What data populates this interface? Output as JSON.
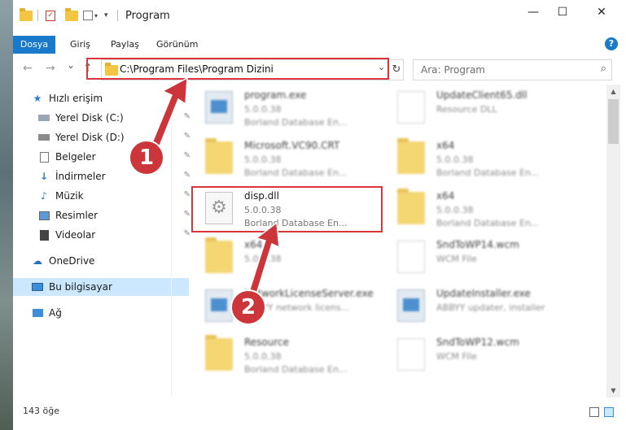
{
  "window": {
    "title": "Program",
    "controls": {
      "minimize": "—",
      "maximize": "☐",
      "close": "✕"
    }
  },
  "ribbon": {
    "tabs": [
      "Dosya",
      "Giriş",
      "Paylaş",
      "Görünüm"
    ],
    "help": "?"
  },
  "nav": {
    "back": "←",
    "forward": "→",
    "recent": "⌄",
    "up": "↑",
    "address": "C:\\Program Files\\Program Dizini",
    "search_placeholder": "Ara: Program"
  },
  "sidebar": {
    "items": [
      {
        "label": "Hızlı erişim",
        "icon": "star-icon"
      },
      {
        "label": "Yerel Disk (C:)",
        "icon": "drive-icon"
      },
      {
        "label": "Yerel Disk (D:)",
        "icon": "drive-icon"
      },
      {
        "label": "Belgeler",
        "icon": "documents-icon"
      },
      {
        "label": "İndirmeler",
        "icon": "download-icon"
      },
      {
        "label": "Müzik",
        "icon": "music-icon"
      },
      {
        "label": "Resimler",
        "icon": "pictures-icon"
      },
      {
        "label": "Videolar",
        "icon": "videos-icon"
      },
      {
        "label": "OneDrive",
        "icon": "cloud-icon"
      },
      {
        "label": "Bu bilgisayar",
        "icon": "computer-icon"
      },
      {
        "label": "Ağ",
        "icon": "network-icon"
      }
    ]
  },
  "files": [
    {
      "name": "program.exe",
      "version": "5.0.0.38",
      "desc": "Borland Database En...",
      "icon": "exe"
    },
    {
      "name": "UpdateClient65.dll",
      "version": "Resource DLL",
      "desc": "",
      "icon": "doc"
    },
    {
      "name": "Microsoft.VC90.CRT",
      "version": "5.0.0.38",
      "desc": "Borland Database En...",
      "icon": "folder"
    },
    {
      "name": "x64",
      "version": "5.0.0.38",
      "desc": "Borland Database En...",
      "icon": "folder"
    },
    {
      "name": "disp.dll",
      "version": "5.0.0.38",
      "desc": "Borland Database En...",
      "icon": "gear"
    },
    {
      "name": "x64",
      "version": "5.0.0.38",
      "desc": "Borland Database En...",
      "icon": "folder"
    },
    {
      "name": "x64",
      "version": "5.0.0.38",
      "desc": "",
      "icon": "folder"
    },
    {
      "name": "SndToWP14.wcm",
      "version": "WCM File",
      "desc": "",
      "icon": "doc"
    },
    {
      "name": "NetworkLicenseServer.exe",
      "version": "ABBYY network licens...",
      "desc": "",
      "icon": "exe"
    },
    {
      "name": "UpdateInstaller.exe",
      "version": "ABBYY updater, installer",
      "desc": "",
      "icon": "exe"
    },
    {
      "name": "Resource",
      "version": "5.0.0.38",
      "desc": "Borland Database En...",
      "icon": "folder"
    },
    {
      "name": "SndToWP12.wcm",
      "version": "WCM File",
      "desc": "",
      "icon": "doc"
    }
  ],
  "status": {
    "count": "143 öğe"
  },
  "callouts": [
    "1",
    "2"
  ]
}
